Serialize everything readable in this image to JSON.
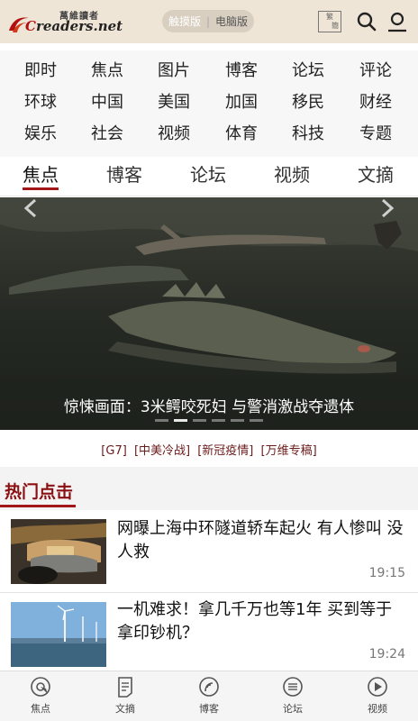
{
  "header": {
    "logo_subtitle": "萬維讀者",
    "logo_text_c": "C",
    "logo_text_rest": "readers.net",
    "version_touch": "触摸版",
    "version_pc": "电脑版",
    "fan_jian_top": "繁",
    "fan_jian_bottom": "簡"
  },
  "categories": [
    [
      "即时",
      "焦点",
      "图片",
      "博客",
      "论坛",
      "评论"
    ],
    [
      "环球",
      "中国",
      "美国",
      "加国",
      "移民",
      "财经"
    ],
    [
      "娱乐",
      "社会",
      "视频",
      "体育",
      "科技",
      "专题"
    ]
  ],
  "tabs": [
    "焦点",
    "博客",
    "论坛",
    "视频",
    "文摘"
  ],
  "carousel": {
    "caption": "惊悚画面：3米鳄咬死妇 与警消激战夺遗体",
    "slide_count": 6,
    "active_index": 1
  },
  "topics": [
    "[G7]",
    "[中美冷战]",
    "[新冠疫情]",
    "[万维专稿]"
  ],
  "hot": {
    "title": "热门点击",
    "items": [
      {
        "title": "网曝上海中环隧道轿车起火 有人惨叫 没人救",
        "time": "19:15"
      },
      {
        "title": "一机难求！拿几千万也等1年 买到等于拿印钞机？",
        "time": "19:24"
      }
    ]
  },
  "bottom_nav": [
    "焦点",
    "文摘",
    "博客",
    "论坛",
    "视频"
  ],
  "colors": {
    "header_bg": "#efe5d6",
    "accent": "#a3171b",
    "hot_title": "#8b0f12"
  }
}
